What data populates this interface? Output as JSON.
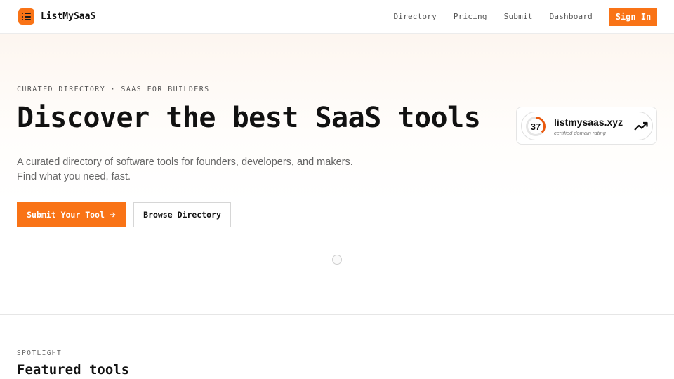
{
  "brand": {
    "name": "ListMySaaS",
    "logo_icon": "list-icon",
    "accent_color": "#f97316"
  },
  "nav": {
    "links": [
      "Directory",
      "Pricing",
      "Submit",
      "Dashboard"
    ],
    "signin_label": "Sign In"
  },
  "hero": {
    "eyebrow": "CURATED DIRECTORY · SAAS FOR BUILDERS",
    "headline": "Discover the best SaaS tools",
    "subtext_line1": "A curated directory of software tools for founders, developers, and makers.",
    "subtext_line2": "Find what you need, fast.",
    "primary_button": "Submit Your Tool",
    "primary_button_icon": "arrow-right-icon",
    "secondary_button": "Browse Directory"
  },
  "rating_badge": {
    "score": "37",
    "score_fraction": 0.37,
    "domain": "listmysaas.xyz",
    "label": "certified domain rating",
    "trend_icon": "trending-up-icon",
    "ring_color": "#ea580c"
  },
  "spotlight": {
    "eyebrow": "SPOTLIGHT",
    "title": "Featured tools"
  }
}
